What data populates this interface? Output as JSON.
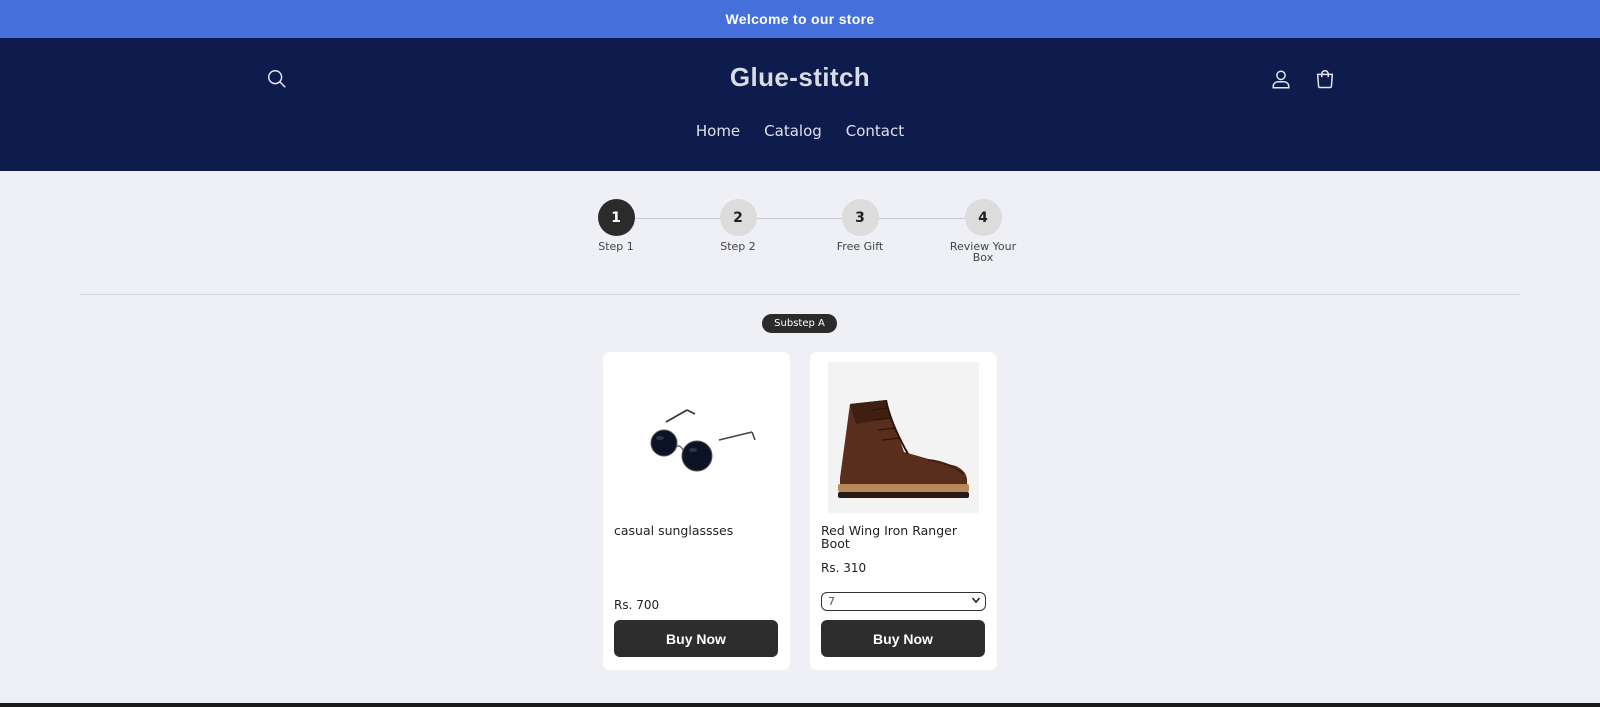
{
  "announcement": "Welcome to our store",
  "header": {
    "logo": "Glue-stitch",
    "nav": [
      "Home",
      "Catalog",
      "Contact"
    ],
    "icons": {
      "search": "search-icon",
      "account": "user-icon",
      "cart": "cart-icon"
    }
  },
  "steps": [
    {
      "num": "1",
      "label": "Step 1",
      "active": true
    },
    {
      "num": "2",
      "label": "Step 2",
      "active": false
    },
    {
      "num": "3",
      "label": "Free Gift",
      "active": false
    },
    {
      "num": "4",
      "label": "Review Your Box",
      "active": false
    }
  ],
  "substep": "Substep A",
  "products": [
    {
      "name": "casual sunglassses",
      "price": "Rs. 700",
      "button": "Buy Now",
      "image": "sunglasses"
    },
    {
      "name": "Red Wing Iron Ranger Boot",
      "price": "Rs. 310",
      "size_value": "7",
      "button": "Buy Now",
      "image": "boot"
    }
  ],
  "colors": {
    "announcement_bg": "#4570dc",
    "header_bg": "#0e1b4d",
    "button_bg": "#2d2d2d"
  }
}
